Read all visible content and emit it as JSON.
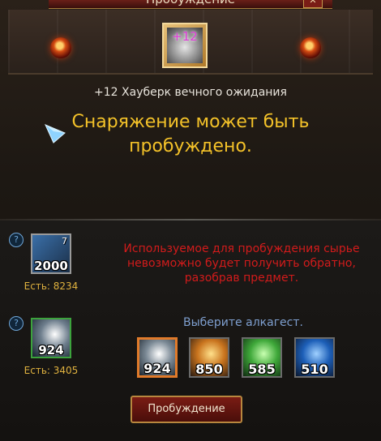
{
  "window": {
    "title": "Пробуждение",
    "close_label": "✕"
  },
  "item": {
    "name": "+12 Хауберк вечного ожидания",
    "enhance_level": "+12"
  },
  "status_message": "Снаряжение может быть пробуждено.",
  "material": {
    "slot_count": "2000",
    "slot_corner": "7",
    "have_label": "Есть: 8234",
    "help": "?"
  },
  "warning_text": "Используемое для пробуждения сырье невозможно будет получить обратно, разобрав предмет.",
  "alkahest": {
    "slot_count": "924",
    "have_label": "Есть: 3405",
    "help": "?",
    "choose_label": "Выберите алкагест.",
    "options": [
      "924",
      "850",
      "585",
      "510"
    ],
    "selected_index": 0
  },
  "colors": {
    "status": "#f4c229",
    "warning": "#d21b1b",
    "have": "#e0b23f",
    "choose": "#7e9fcf",
    "selected_border": "#e07a2a"
  },
  "actions": {
    "awaken_label": "Пробуждение"
  }
}
